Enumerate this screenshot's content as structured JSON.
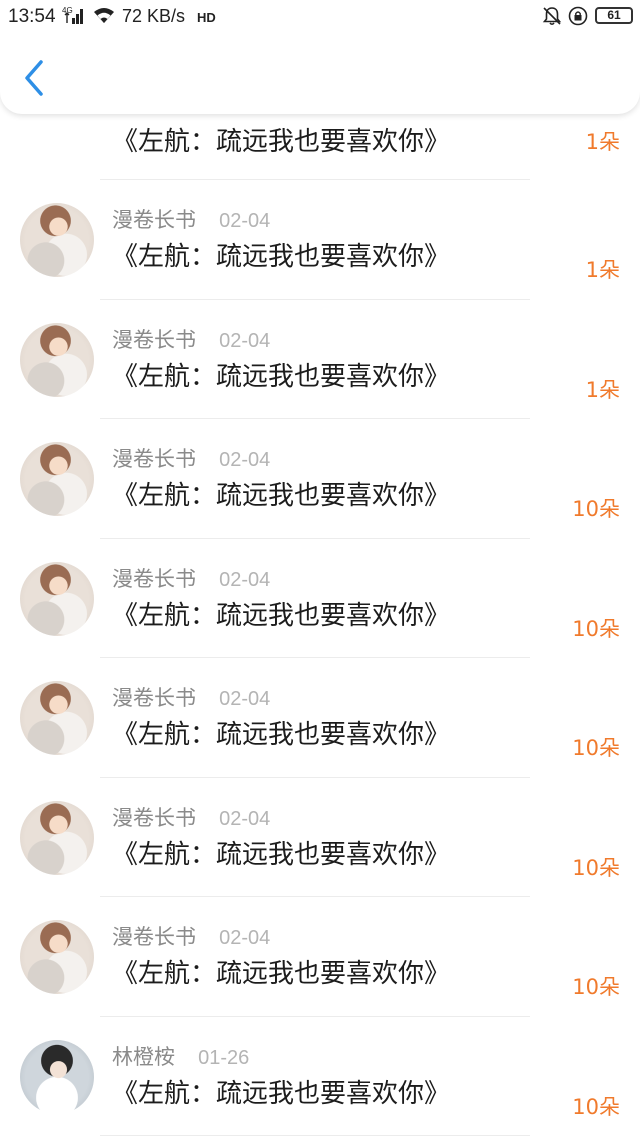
{
  "status_bar": {
    "time": "13:54",
    "network_label": "4G",
    "speed": "72 KB/s",
    "hd_label": "HD",
    "battery_level": "61"
  },
  "header": {
    "back_icon": "chevron-left-icon"
  },
  "colors": {
    "accent_blue": "#2e8fe6",
    "flower_orange": "#f07a2c",
    "title_text": "#1c1c1c",
    "meta_text": "#8a8a8a"
  },
  "rows": [
    {
      "name": "",
      "date": "",
      "title": "《左航：疏远我也要喜欢你》",
      "count": "1朵",
      "avatar": "avatar-girl-cat"
    },
    {
      "name": "漫卷长书",
      "date": "02-04",
      "title": "《左航：疏远我也要喜欢你》",
      "count": "1朵",
      "avatar": "avatar-girl-cat"
    },
    {
      "name": "漫卷长书",
      "date": "02-04",
      "title": "《左航：疏远我也要喜欢你》",
      "count": "1朵",
      "avatar": "avatar-girl-cat"
    },
    {
      "name": "漫卷长书",
      "date": "02-04",
      "title": "《左航：疏远我也要喜欢你》",
      "count": "10朵",
      "avatar": "avatar-girl-cat"
    },
    {
      "name": "漫卷长书",
      "date": "02-04",
      "title": "《左航：疏远我也要喜欢你》",
      "count": "10朵",
      "avatar": "avatar-girl-cat"
    },
    {
      "name": "漫卷长书",
      "date": "02-04",
      "title": "《左航：疏远我也要喜欢你》",
      "count": "10朵",
      "avatar": "avatar-girl-cat"
    },
    {
      "name": "漫卷长书",
      "date": "02-04",
      "title": "《左航：疏远我也要喜欢你》",
      "count": "10朵",
      "avatar": "avatar-girl-cat"
    },
    {
      "name": "漫卷长书",
      "date": "02-04",
      "title": "《左航：疏远我也要喜欢你》",
      "count": "10朵",
      "avatar": "avatar-girl-cat"
    },
    {
      "name": "林橙桉",
      "date": "01-26",
      "title": "《左航：疏远我也要喜欢你》",
      "count": "10朵",
      "avatar": "avatar-boy-portrait"
    }
  ]
}
